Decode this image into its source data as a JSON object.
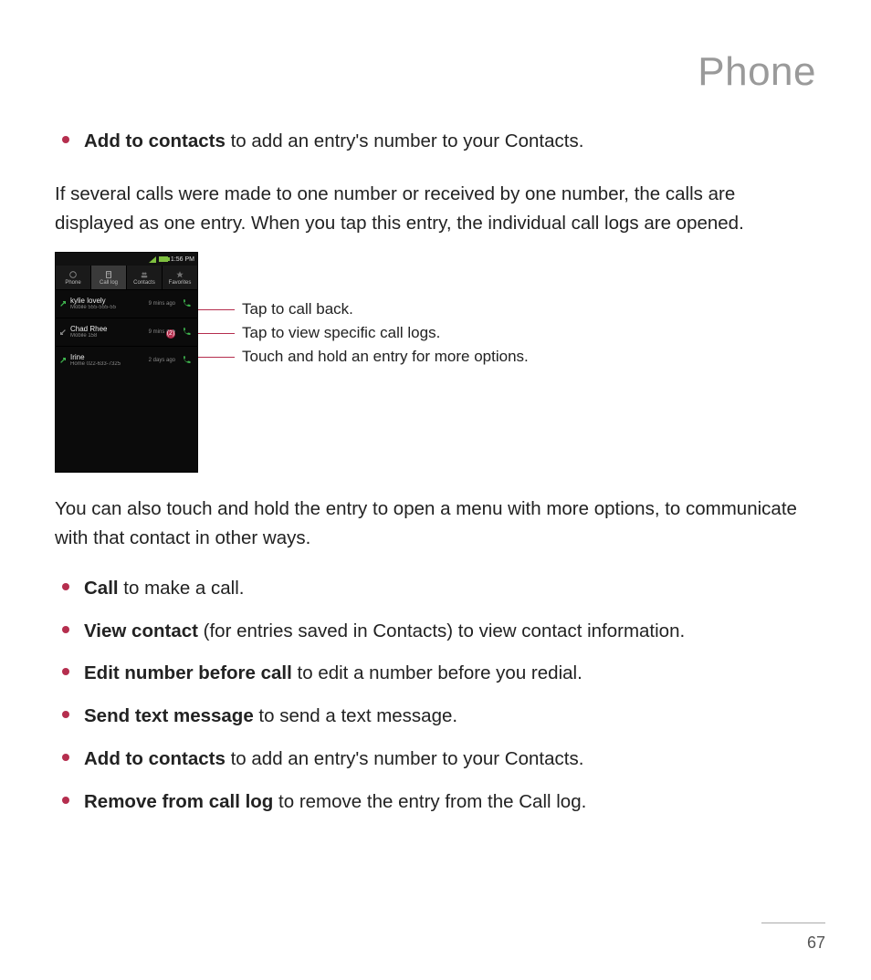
{
  "page": {
    "title": "Phone",
    "number": "67"
  },
  "top_bullet": {
    "bold": "Add to contacts",
    "rest": " to add an entry's number to your Contacts."
  },
  "para1": "If several calls were made to one number or received by one number, the calls are displayed as one entry. When you tap this entry, the individual call logs are opened.",
  "phone": {
    "time": "1:56 PM",
    "tabs": {
      "phone": "Phone",
      "calllog": "Call log",
      "contacts": "Contacts",
      "favorites": "Favorites"
    },
    "entries": [
      {
        "name": "kylie lovely",
        "sub": "Mobile 555-555-55",
        "time": "9 mins ago",
        "dir": "out",
        "badge": ""
      },
      {
        "name": "Chad Rhee",
        "sub": "Mobile 158",
        "time": "9 mins ago",
        "dir": "in",
        "badge": "(2)"
      },
      {
        "name": "Irine",
        "sub": "Home 022-633-7325",
        "time": "2 days ago",
        "dir": "out",
        "badge": ""
      }
    ]
  },
  "callouts": {
    "c1": "Tap to call back.",
    "c2": "Tap to view specific call logs.",
    "c3": "Touch and hold an entry for more options."
  },
  "para2": "You can also touch and hold the entry to open a menu with more options, to communicate with that contact in other ways.",
  "bullets": [
    {
      "bold": "Call",
      "rest": " to make a call."
    },
    {
      "bold": "View contact",
      "rest": " (for entries saved in Contacts) to view contact information."
    },
    {
      "bold": "Edit number before call",
      "rest": " to edit a number before you redial."
    },
    {
      "bold": "Send text message",
      "rest": " to send a text message."
    },
    {
      "bold": "Add to contacts",
      "rest": " to add an entry's number to your Contacts."
    },
    {
      "bold": "Remove from call log",
      "rest": " to remove the entry from the Call log."
    }
  ]
}
